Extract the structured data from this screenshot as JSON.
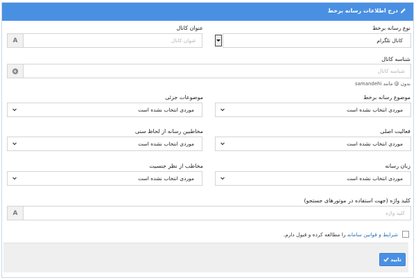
{
  "header": {
    "title": "درج اطلاعات رسانه برخط",
    "icon": "pencil-icon"
  },
  "colors": {
    "primary": "#4a90e2",
    "link": "#2a6db0"
  },
  "form": {
    "media_type": {
      "label": "نوع رسانه برخط",
      "value": "کانال تلگرام"
    },
    "channel_title": {
      "label": "عنوان کانال",
      "placeholder": "عنوان کانال",
      "addon": "A"
    },
    "channel_id": {
      "label": "شناسه کانال",
      "placeholder": "شناسه کانال",
      "hint": "بدون @ مانند samandehi"
    },
    "topic": {
      "label": "موضوع رسانه برخط",
      "value": "موردی انتخاب نشده است"
    },
    "subtopics": {
      "label": "موضوعات جزئی",
      "value": "موردی انتخاب نشده است"
    },
    "main_activity": {
      "label": "فعالیت اصلی",
      "value": "موردی انتخاب نشده است"
    },
    "age_audience": {
      "label": "مخاطبین رسانه از لحاظ سنی",
      "value": "موردی انتخاب نشده است"
    },
    "language": {
      "label": "زبان رسانه",
      "value": "موردی انتخاب نشده است"
    },
    "gender_audience": {
      "label": "مخاطب از نظر جنسیت",
      "value": "موردی انتخاب نشده است"
    },
    "keywords": {
      "label": "کلید واژه (جهت استفاده در موتورهای جستجو)",
      "placeholder": "کلید واژه",
      "addon": "A"
    },
    "terms": {
      "link_text": "شرایط و قوانین سامانه",
      "rest_text": " را مطالعه کرده و قبول دارم.",
      "checked": false
    }
  },
  "footer": {
    "submit_label": "تایید"
  }
}
